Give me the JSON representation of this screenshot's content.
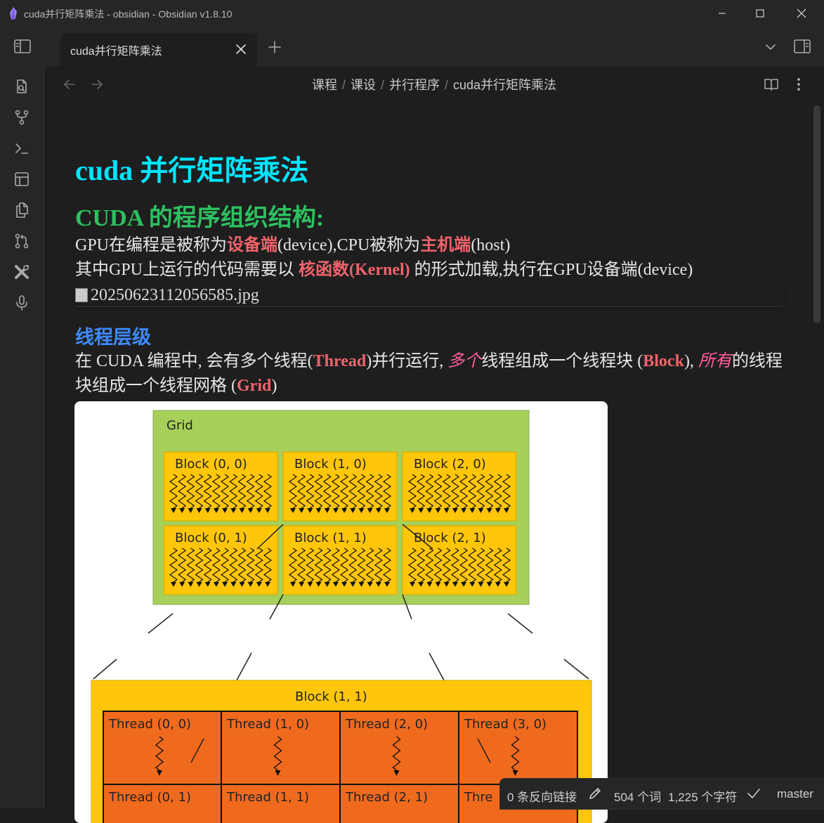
{
  "window": {
    "title": "cuda并行矩阵乘法 - obsidian - Obsidian v1.8.10"
  },
  "tab": {
    "label": "cuda并行矩阵乘法"
  },
  "breadcrumb": [
    "课程",
    "课设",
    "并行程序",
    "cuda并行矩阵乘法"
  ],
  "note": {
    "h1": "cuda 并行矩阵乘法",
    "h2": "CUDA 的程序组织结构:",
    "p1": {
      "a": "GPU在编程是被称为",
      "b": "设备端",
      "c": "(device),CPU被称为",
      "d": "主机端",
      "e": "(host)"
    },
    "p2": {
      "a": "其中GPU上运行的代码需要以 ",
      "b": "核函数(Kernel)",
      "c": " 的形式加载,执行在GPU设备端(device)"
    },
    "broken_image": "20250623112056585.jpg",
    "h3": "线程层级",
    "p3": {
      "a": "在 CUDA 编程中, 会有多个线程(",
      "b": "Thread",
      "c": ")并行运行, ",
      "d": "多个",
      "e": "线程组成一个线程块 (",
      "f": "Block",
      "g": "), ",
      "h": "所有",
      "i": "的线程块组成一个线程网格 (",
      "j": "Grid",
      "k": ")"
    }
  },
  "figure": {
    "grid_label": "Grid",
    "blocks": [
      "Block (0, 0)",
      "Block (1, 0)",
      "Block (2, 0)",
      "Block (0, 1)",
      "Block (1, 1)",
      "Block (2, 1)"
    ],
    "zoom_block_label": "Block (1, 1)",
    "threads": [
      "Thread (0, 0)",
      "Thread (1, 0)",
      "Thread (2, 0)",
      "Thread (3, 0)",
      "Thread (0, 1)",
      "Thread (1, 1)",
      "Thread (2, 1)",
      "Thre"
    ],
    "colors": {
      "grid": "#a6d05a",
      "block": "#ffc60a",
      "thread": "#f06a1e"
    }
  },
  "status": {
    "backlinks": "0 条反向链接",
    "words": "504 个词",
    "chars": "1,225 个字符",
    "branch": "master"
  },
  "colors": {
    "h1": "#00e5ff",
    "h2": "#2ec060",
    "h3": "#3d8bff",
    "highlight": "#f0636b",
    "italic": "#ff5fa0"
  }
}
